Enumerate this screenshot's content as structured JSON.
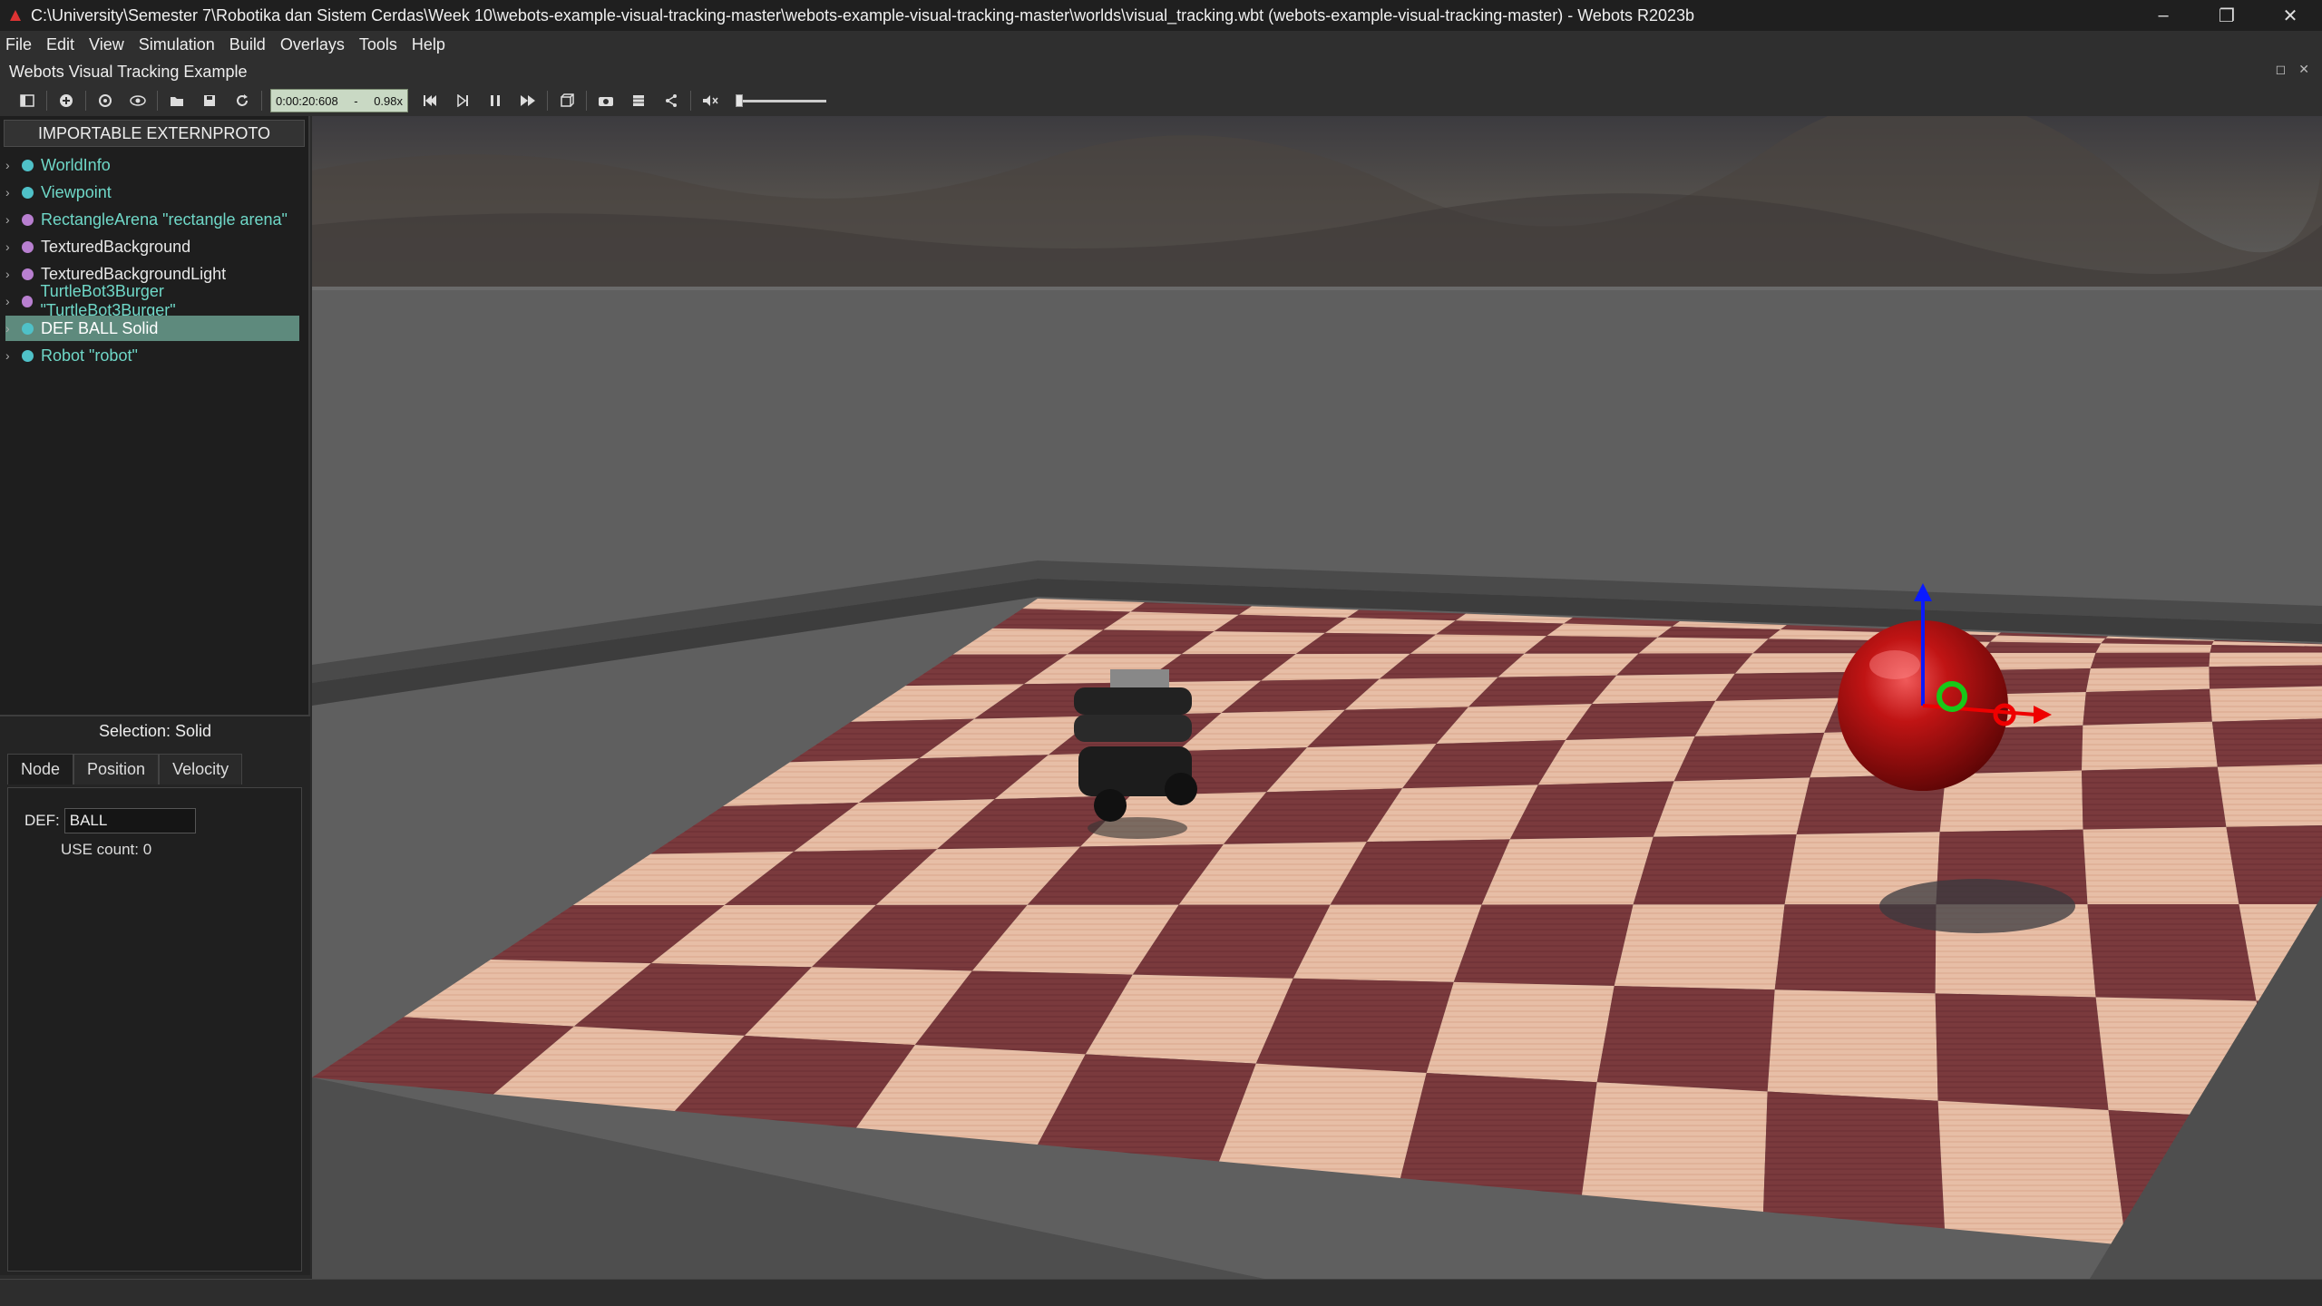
{
  "window": {
    "title": "C:\\University\\Semester 7\\Robotika dan Sistem Cerdas\\Week 10\\webots-example-visual-tracking-master\\webots-example-visual-tracking-master\\worlds\\visual_tracking.wbt (webots-example-visual-tracking-master) - Webots R2023b",
    "controls": [
      "minimize-icon",
      "restore-icon",
      "close-icon"
    ]
  },
  "menu": [
    "File",
    "Edit",
    "View",
    "Simulation",
    "Build",
    "Overlays",
    "Tools",
    "Help"
  ],
  "world_title": "Webots Visual Tracking Example",
  "toolbar": {
    "time": "0:00:20:608",
    "separator": "-",
    "speed": "0.98x",
    "volume_level": 0.0
  },
  "scene_tree": {
    "header": "IMPORTABLE EXTERNPROTO",
    "items": [
      {
        "label": "WorldInfo",
        "dot": "#4fc1c8",
        "text": "#6fd8c8"
      },
      {
        "label": "Viewpoint",
        "dot": "#4fc1c8",
        "text": "#6fd8c8"
      },
      {
        "label": "RectangleArena \"rectangle arena\"",
        "dot": "#b87fd0",
        "text": "#6fd8c8"
      },
      {
        "label": "TexturedBackground",
        "dot": "#b87fd0",
        "text": "#e8e8e8"
      },
      {
        "label": "TexturedBackgroundLight",
        "dot": "#b87fd0",
        "text": "#e8e8e8"
      },
      {
        "label": "TurtleBot3Burger \"TurtleBot3Burger\"",
        "dot": "#b87fd0",
        "text": "#6fd8c8"
      },
      {
        "label": "DEF BALL Solid",
        "dot": "#4fc1c8",
        "text": "#ffffff",
        "selected": true
      },
      {
        "label": "Robot \"robot\"",
        "dot": "#4fc1c8",
        "text": "#6fd8c8"
      }
    ]
  },
  "selection": {
    "title": "Selection: Solid",
    "tabs": [
      "Node",
      "Position",
      "Velocity"
    ],
    "def_label": "DEF:",
    "def_value": "BALL",
    "use_count": "USE count: 0"
  }
}
